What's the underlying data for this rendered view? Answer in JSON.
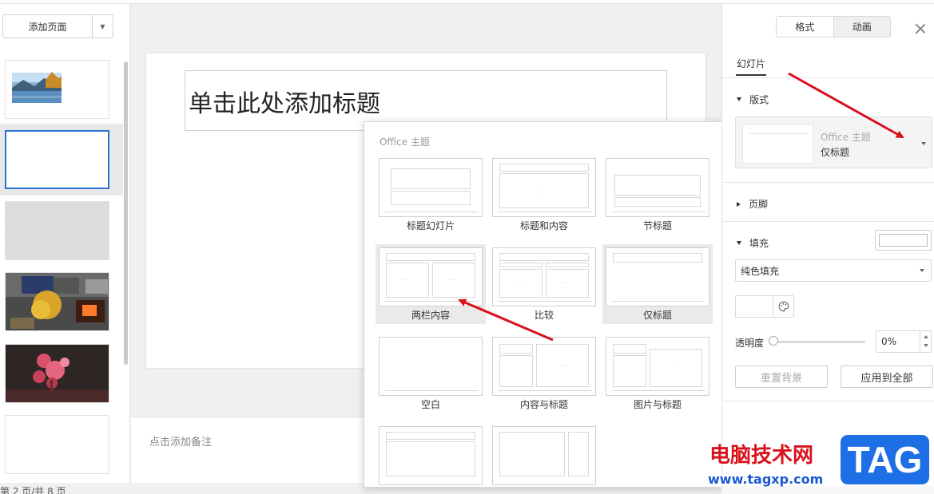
{
  "left_panel": {
    "add_page_label": "添加页面",
    "page_status": "第 2 页/共 8 页"
  },
  "slide": {
    "title_placeholder": "单击此处添加标题"
  },
  "notes": {
    "placeholder": "点击添加备注"
  },
  "layout_popup": {
    "header": "Office 主题",
    "layouts": [
      {
        "name": "标题幻灯片"
      },
      {
        "name": "标题和内容"
      },
      {
        "name": "节标题"
      },
      {
        "name": "两栏内容"
      },
      {
        "name": "比较"
      },
      {
        "name": "仅标题"
      },
      {
        "name": "空白"
      },
      {
        "name": "内容与标题"
      },
      {
        "name": "图片与标题"
      }
    ]
  },
  "format_panel": {
    "tabs": [
      "格式",
      "动画"
    ],
    "active_tab": "格式",
    "slide_tab": "幻灯片",
    "layout_section": "版式",
    "layout_theme": "Office 主题",
    "layout_current": "仅标题",
    "footer_section": "页脚",
    "fill_section": "填充",
    "fill_type": "纯色填充",
    "opacity_label": "透明度",
    "opacity_value": "0%",
    "opacity": 0,
    "reset_bg_label": "重置背景",
    "apply_all_label": "应用到全部"
  },
  "watermark": {
    "site_name": "电脑技术网",
    "url": "www.tagxp.com",
    "badge": "TAG"
  },
  "colors": {
    "accent": "#2a74d6",
    "arrow": "#d9111c",
    "badge": "#1e6fe6"
  }
}
